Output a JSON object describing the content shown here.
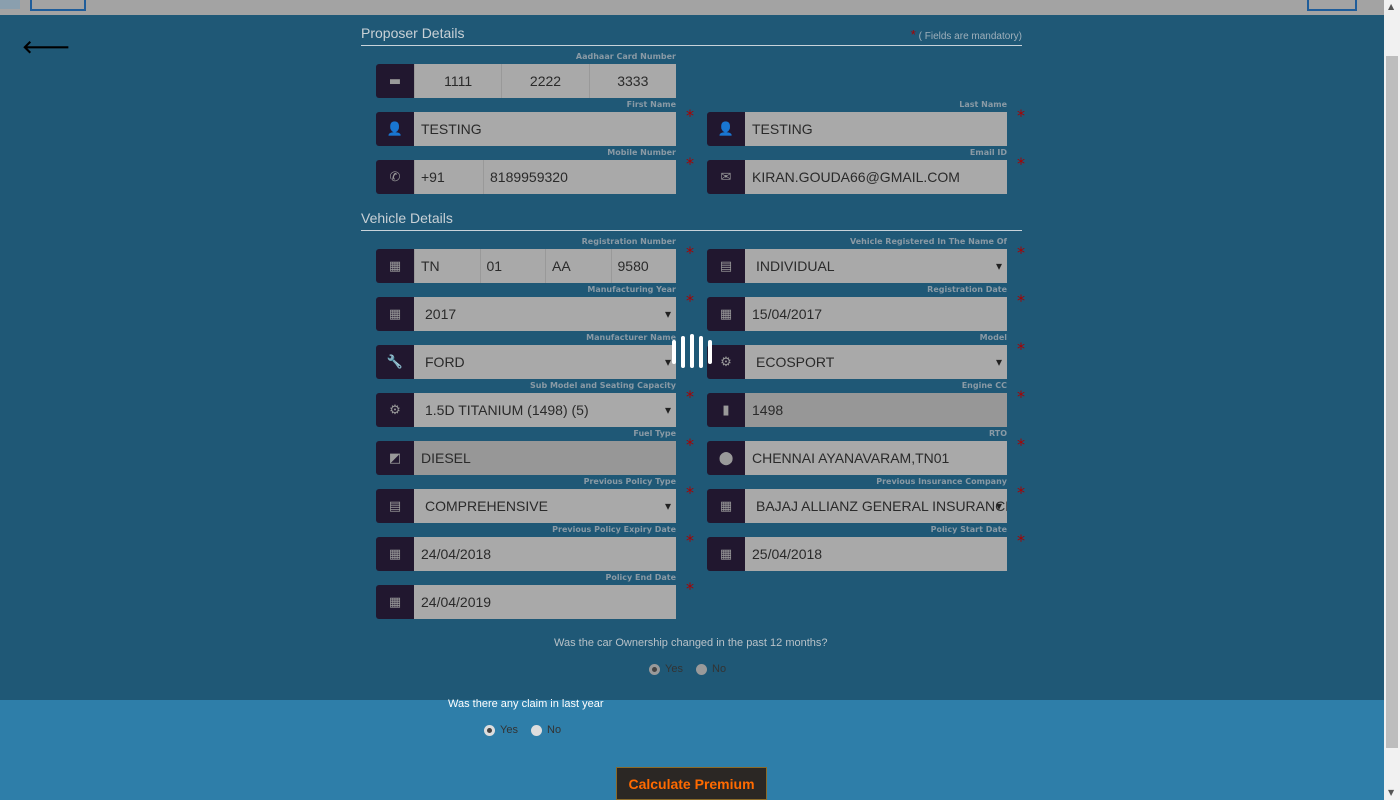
{
  "nav": {
    "back_icon": "arrow-left-icon"
  },
  "proposer": {
    "title": "Proposer Details",
    "mandatory_note": "( Fields are mandatory)",
    "mandatory_star": "*"
  },
  "vehicle": {
    "title": "Vehicle Details"
  },
  "fields": [
    {
      "id": "aadhaar",
      "label": "Aadhaar Card Number",
      "icon": "id-card-icon",
      "glyph": "▬",
      "segments": [
        "1111",
        "2222",
        "3333"
      ],
      "center": true,
      "col": 0,
      "row": 0,
      "required": false
    },
    {
      "id": "first-name",
      "label": "First Name",
      "icon": "user-icon",
      "glyph": "👤",
      "value": "TESTING",
      "col": 0,
      "row": 1,
      "required": true
    },
    {
      "id": "last-name",
      "label": "Last Name",
      "icon": "user-icon",
      "glyph": "👤",
      "value": "TESTING",
      "col": 1,
      "row": 1,
      "required": true
    },
    {
      "id": "mobile",
      "label": "Mobile Number",
      "icon": "phone-icon",
      "glyph": "✆",
      "segments": [
        "+91",
        "8189959320"
      ],
      "segw": [
        1,
        3
      ],
      "col": 0,
      "row": 2,
      "required": true
    },
    {
      "id": "email",
      "label": "Email ID",
      "icon": "envelope-icon",
      "glyph": "✉",
      "value": "KIRAN.GOUDA66@GMAIL.COM",
      "col": 1,
      "row": 2,
      "required": true
    },
    {
      "id": "registration-number",
      "label": "Registration Number",
      "icon": "grid-icon",
      "glyph": "▦",
      "segments": [
        "TN",
        "01",
        "AA",
        "9580"
      ],
      "col": 0,
      "row": 3,
      "required": true
    },
    {
      "id": "registered-name",
      "label": "Vehicle Registered In The Name Of",
      "icon": "list-icon",
      "glyph": "▤",
      "value": "INDIVIDUAL",
      "select": true,
      "col": 1,
      "row": 3,
      "required": true
    },
    {
      "id": "manufacturing-year",
      "label": "Manufacturing Year",
      "icon": "calendar-icon",
      "glyph": "▦",
      "value": "2017",
      "select": true,
      "col": 0,
      "row": 4,
      "required": true
    },
    {
      "id": "registration-date",
      "label": "Registration Date",
      "icon": "calendar-icon",
      "glyph": "▦",
      "value": "15/04/2017",
      "col": 1,
      "row": 4,
      "required": true
    },
    {
      "id": "manufacturer",
      "label": "Manufacturer Name",
      "icon": "wrench-icon",
      "glyph": "🔧",
      "value": "FORD",
      "select": true,
      "col": 0,
      "row": 5,
      "required": false
    },
    {
      "id": "model",
      "label": "Model",
      "icon": "gear-icon",
      "glyph": "⚙",
      "value": "ECOSPORT",
      "select": true,
      "col": 1,
      "row": 5,
      "required": true
    },
    {
      "id": "sub-model",
      "label": "Sub Model and Seating Capacity",
      "icon": "gear-icon",
      "glyph": "⚙",
      "value": "1.5D TITANIUM (1498) (5)",
      "select": true,
      "col": 0,
      "row": 6,
      "required": true
    },
    {
      "id": "engine-cc",
      "label": "Engine CC",
      "icon": "bar-chart-icon",
      "glyph": "▮",
      "value": "1498",
      "disabled": true,
      "col": 1,
      "row": 6,
      "required": true
    },
    {
      "id": "fuel-type",
      "label": "Fuel Type",
      "icon": "eraser-icon",
      "glyph": "◩",
      "value": "DIESEL",
      "disabled": true,
      "col": 0,
      "row": 7,
      "required": true
    },
    {
      "id": "rto",
      "label": "RTO",
      "icon": "map-marker-icon",
      "glyph": "⬤",
      "value": "CHENNAI AYANAVARAM,TN01",
      "col": 1,
      "row": 7,
      "required": true
    },
    {
      "id": "previous-policy-type",
      "label": "Previous Policy Type",
      "icon": "list-icon",
      "glyph": "▤",
      "value": "COMPREHENSIVE",
      "select": true,
      "col": 0,
      "row": 8,
      "required": true
    },
    {
      "id": "previous-insurer",
      "label": "Previous Insurance Company",
      "icon": "calendar-icon",
      "glyph": "▦",
      "value": "BAJAJ ALLIANZ GENERAL INSURANCE",
      "select": true,
      "col": 1,
      "row": 8,
      "required": true
    },
    {
      "id": "previous-expiry",
      "label": "Previous Policy Expiry Date",
      "icon": "calendar-icon",
      "glyph": "▦",
      "value": "24/04/2018",
      "col": 0,
      "row": 9,
      "required": true
    },
    {
      "id": "policy-start",
      "label": "Policy Start Date",
      "icon": "calendar-icon",
      "glyph": "▦",
      "value": "25/04/2018",
      "col": 1,
      "row": 9,
      "required": true
    },
    {
      "id": "policy-end",
      "label": "Policy End Date",
      "icon": "calendar-icon",
      "glyph": "▦",
      "value": "24/04/2019",
      "col": 0,
      "row": 10,
      "required": true
    }
  ],
  "ownership": {
    "question": "Was the car Ownership changed in the past 12 months?",
    "yes": "Yes",
    "no": "No",
    "selected": "yes"
  },
  "claim": {
    "question": "Was there any claim in last year",
    "yes": "Yes",
    "no": "No",
    "selected": "yes"
  },
  "calculate_label": "Calculate Premium"
}
